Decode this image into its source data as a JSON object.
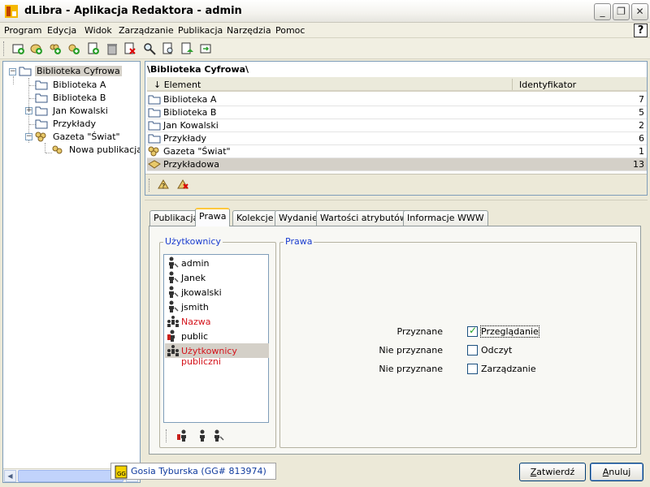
{
  "window": {
    "title": "dLibra - Aplikacja Redaktora - admin",
    "min_label": "_",
    "max_label": "❐",
    "close_label": "✕"
  },
  "menu": [
    "Program",
    "Edycja",
    "Widok",
    "Zarządzanie",
    "Publikacja",
    "Narzędzia",
    "Pomoc"
  ],
  "help_label": "?",
  "toolbar_icons": [
    "add-collection-icon",
    "add-directory-icon",
    "add-group-publication-icon",
    "add-publication-icon",
    "add-edition-icon",
    "delete-icon",
    "remove-icon",
    "search-icon",
    "find-next-icon",
    "export-icon",
    "import-icon"
  ],
  "tree": {
    "items": [
      {
        "label": "Biblioteka Cyfrowa",
        "icon": "folder-icon"
      },
      {
        "label": "Biblioteka A",
        "icon": "folder-icon"
      },
      {
        "label": "Biblioteka B",
        "icon": "folder-icon"
      },
      {
        "label": "Jan Kowalski",
        "icon": "folder-icon"
      },
      {
        "label": "Przykłady",
        "icon": "folder-icon"
      },
      {
        "label": "Gazeta \"Świat\"",
        "icon": "group-publication-icon"
      },
      {
        "label": "Nowa publikacja",
        "icon": "group-publication-icon"
      }
    ],
    "expand_minus": "−",
    "expand_plus": "+",
    "scroll_left": "◀",
    "scroll_right": "▶"
  },
  "list": {
    "path": "\\Biblioteka Cyfrowa\\",
    "col_element": "↓ Element",
    "col_id": "Identyfikator",
    "rows": [
      {
        "name": "Biblioteka A",
        "id": "7",
        "icon": "folder-icon"
      },
      {
        "name": "Biblioteka B",
        "id": "5",
        "icon": "folder-icon"
      },
      {
        "name": "Jan Kowalski",
        "id": "2",
        "icon": "folder-icon"
      },
      {
        "name": "Przykłady",
        "id": "6",
        "icon": "folder-icon"
      },
      {
        "name": "Gazeta \"Świat\"",
        "id": "1",
        "icon": "group-publication-icon"
      },
      {
        "name": "Przykładowa",
        "id": "13",
        "icon": "publication-icon"
      }
    ]
  },
  "tabs": [
    "Publikacja",
    "Prawa",
    "Kolekcje",
    "Wydanie",
    "Wartości atrybutów",
    "Informacje WWW"
  ],
  "users_group": {
    "title": "Użytkownicy",
    "items": [
      {
        "name": "admin",
        "icon": "user-icon",
        "red": false
      },
      {
        "name": "Janek",
        "icon": "user-icon",
        "red": false
      },
      {
        "name": "jkowalski",
        "icon": "user-icon",
        "red": false
      },
      {
        "name": "jsmith",
        "icon": "user-icon",
        "red": false
      },
      {
        "name": "Nazwa",
        "icon": "group-icon",
        "red": true
      },
      {
        "name": "public",
        "icon": "public-user-icon",
        "red": false
      },
      {
        "name": "Użytkownicy publiczni",
        "icon": "group-icon",
        "red": true
      }
    ]
  },
  "rights_group": {
    "title": "Prawa",
    "rows": [
      {
        "state": "Przyznane",
        "label": "Przeglądanie",
        "checked": true
      },
      {
        "state": "Nie przyznane",
        "label": "Odczyt",
        "checked": false
      },
      {
        "state": "Nie przyznane",
        "label": "Zarządzanie",
        "checked": false
      }
    ]
  },
  "status": {
    "text": "Gosia Tyburska (GG# 813974)",
    "icon_text": "GG"
  },
  "buttons": {
    "ok_accel": "Z",
    "ok_rest": "atwierdź",
    "cancel_accel": "A",
    "cancel_rest": "nuluj"
  },
  "colors": {
    "accent": "#ffc83c",
    "red_text": "#d4131b",
    "group_title": "#1a3ccf",
    "status_text": "#0f3a9e"
  }
}
